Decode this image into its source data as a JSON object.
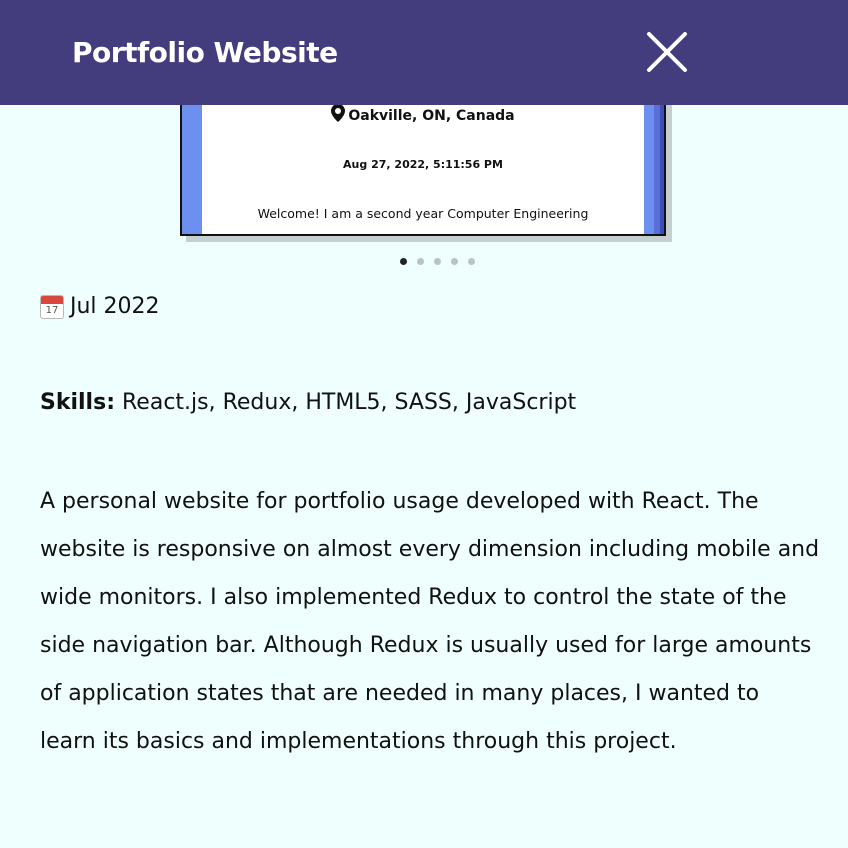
{
  "header": {
    "title": "Portfolio Website"
  },
  "preview": {
    "location": "Oakville, ON, Canada",
    "datetime": "Aug 27, 2022, 5:11:56 PM",
    "welcome": "Welcome! I am a second year Computer Engineering"
  },
  "carousel": {
    "count": 5,
    "active_index": 0
  },
  "project": {
    "date_icon": "calendar-icon",
    "calendar_day": "17",
    "date": "Jul 2022",
    "skills_label": "Skills:",
    "skills": "React.js, Redux, HTML5, SASS, JavaScript",
    "description": "A personal website for portfolio usage developed with React. The website is responsive on almost every dimension including mobile and wide monitors. I also implemented Redux to control the state of the side navigation bar. Although Redux is usually used for large amounts of application states that are needed in many places, I wanted to learn its basics and implementations through this project."
  },
  "colors": {
    "header_bg": "#433d7e",
    "page_bg": "#eefffe",
    "frame_blue": "#6c8ff0"
  }
}
